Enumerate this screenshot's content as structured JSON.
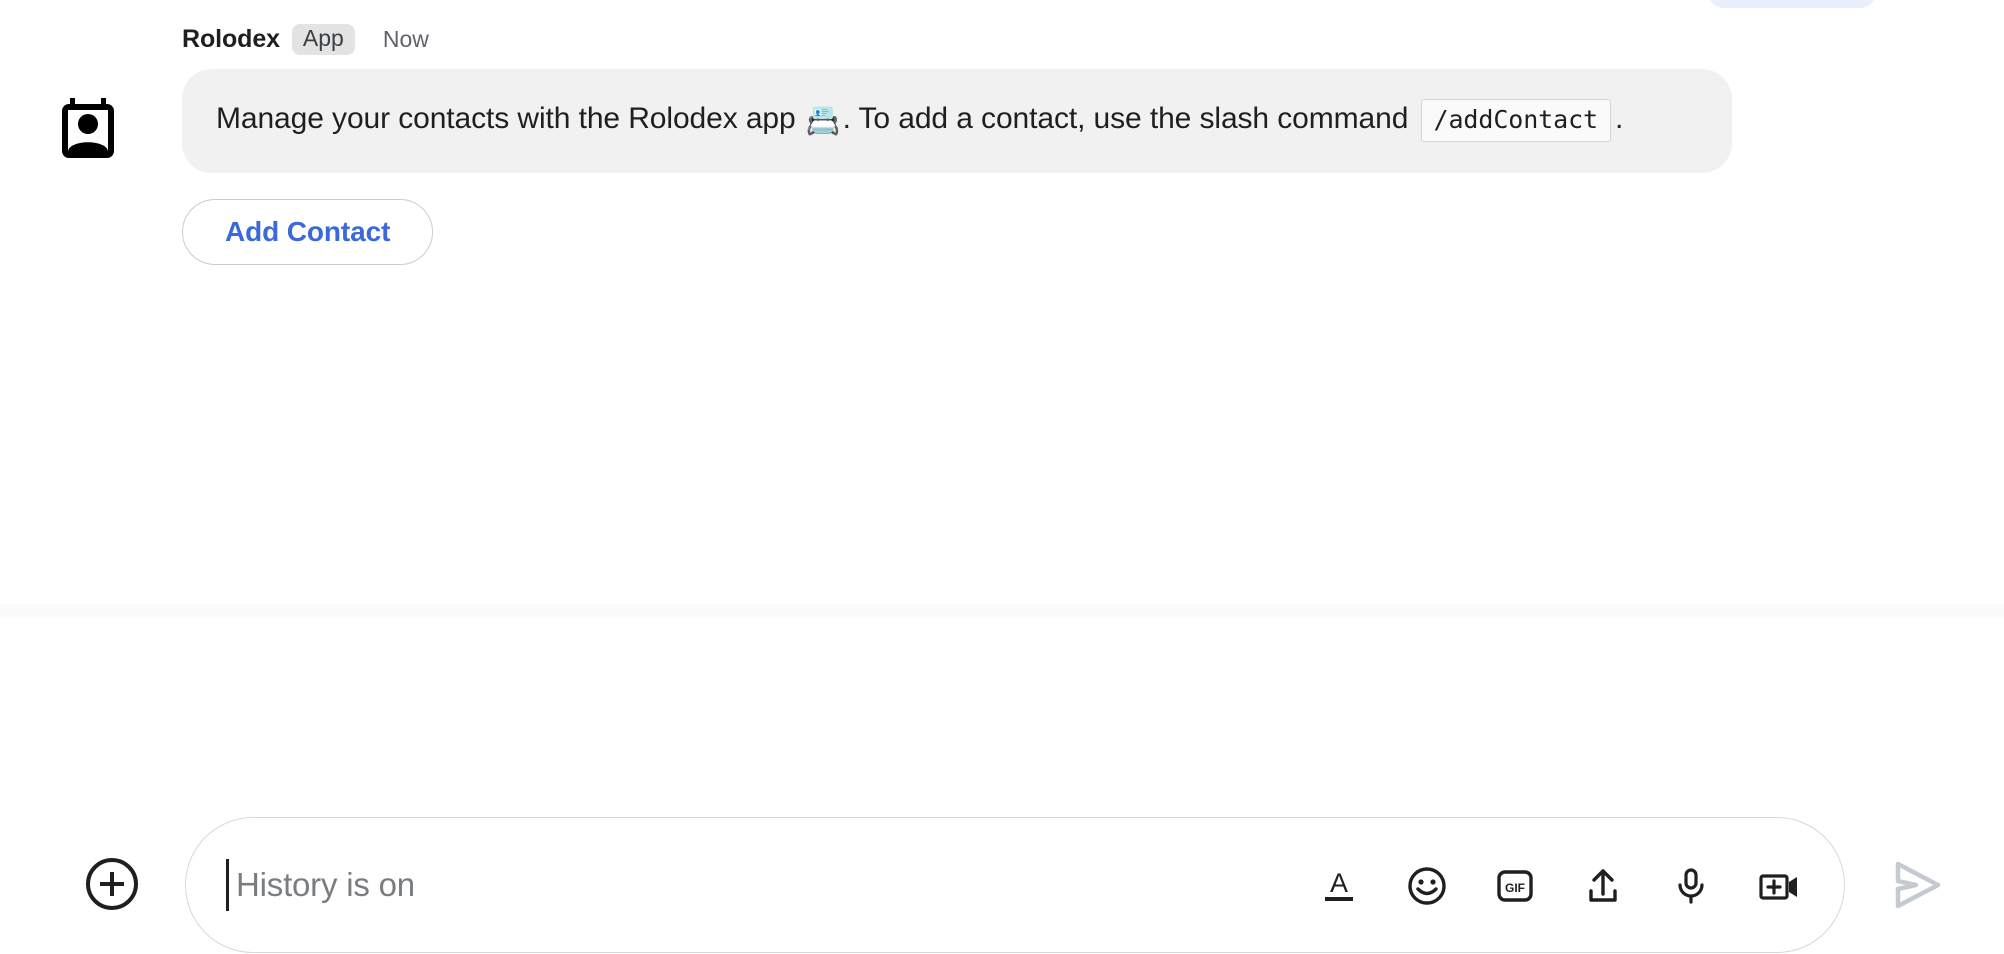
{
  "message": {
    "sender": "Rolodex",
    "badge": "App",
    "timestamp": "Now",
    "avatar_icon": "contact-card-icon",
    "body": {
      "text_before_emoji": "Manage your contacts with the Rolodex app ",
      "emoji": "📇",
      "text_after_emoji": ". To add a contact, use the slash command ",
      "code_chip": "/addContact",
      "text_end": "."
    },
    "action_button": {
      "label": "Add Contact",
      "text_color": "#3B69DB",
      "border_color": "#C9CCD1"
    },
    "bubble_color": "#F1F1F1",
    "badge_color": "#E3E3E3"
  },
  "composer": {
    "add_button_icon": "plus-circle-icon",
    "input": {
      "value": "",
      "placeholder": "History is on"
    },
    "tools": [
      {
        "name": "format-text-icon",
        "label": "A"
      },
      {
        "name": "emoji-icon",
        "label": ""
      },
      {
        "name": "gif-icon",
        "label": "GIF"
      },
      {
        "name": "upload-icon",
        "label": ""
      },
      {
        "name": "microphone-icon",
        "label": ""
      },
      {
        "name": "add-video-icon",
        "label": ""
      }
    ],
    "send_button": {
      "icon": "send-icon",
      "color": "#C5CAD2",
      "enabled": false
    }
  }
}
